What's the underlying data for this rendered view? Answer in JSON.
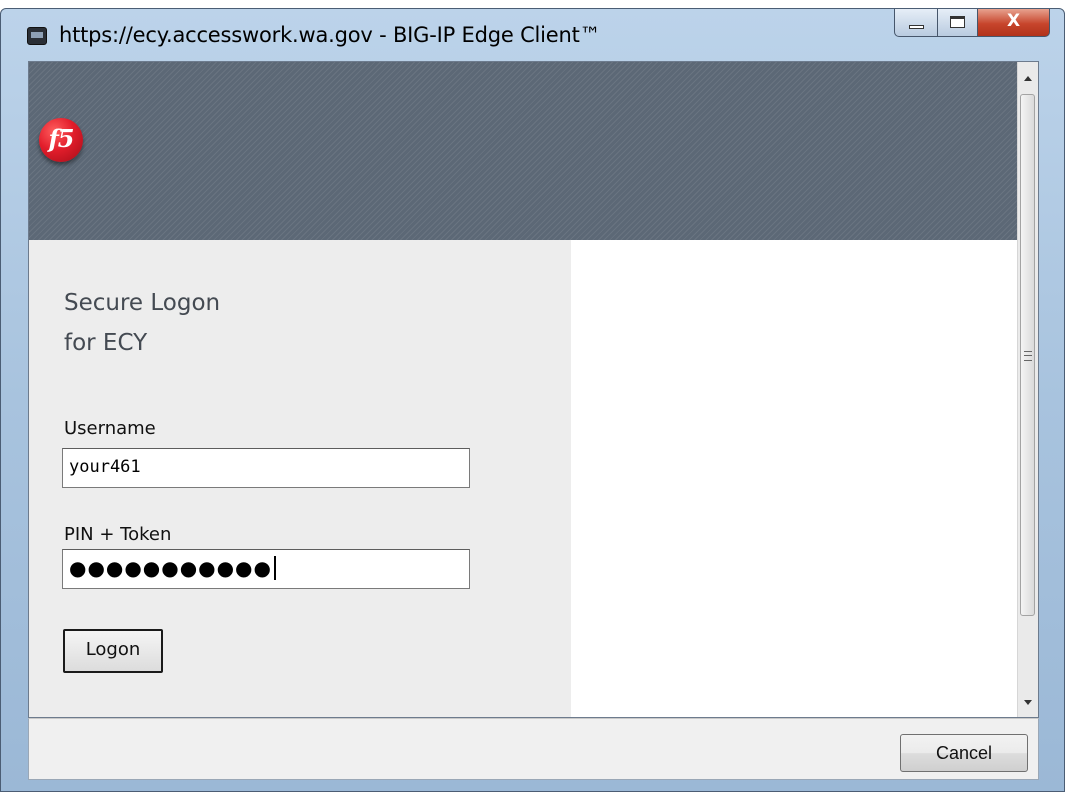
{
  "window": {
    "title": "https://ecy.accesswork.wa.gov - BIG-IP Edge Client™",
    "close_glyph": "X"
  },
  "banner": {
    "logo_text": "f5"
  },
  "form": {
    "heading_line1": "Secure Logon",
    "heading_line2": "for ECY",
    "username_label": "Username",
    "username_value": "your461",
    "pin_label": "PIN + Token",
    "pin_masked_value": "●●●●●●●●●●●",
    "logon_label": "Logon"
  },
  "footer": {
    "cancel_label": "Cancel"
  },
  "icons": {
    "app": "app-window-icon",
    "minimize": "minimize-icon",
    "maximize": "maximize-icon",
    "close": "close-icon",
    "scroll_up": "scroll-up-arrow-icon",
    "scroll_down": "scroll-down-arrow-icon",
    "logo": "f5-logo"
  },
  "colors": {
    "banner": "#5c6876",
    "left_panel": "#ededed",
    "logo_red": "#e21d2b",
    "close_button": "#c7452c"
  }
}
